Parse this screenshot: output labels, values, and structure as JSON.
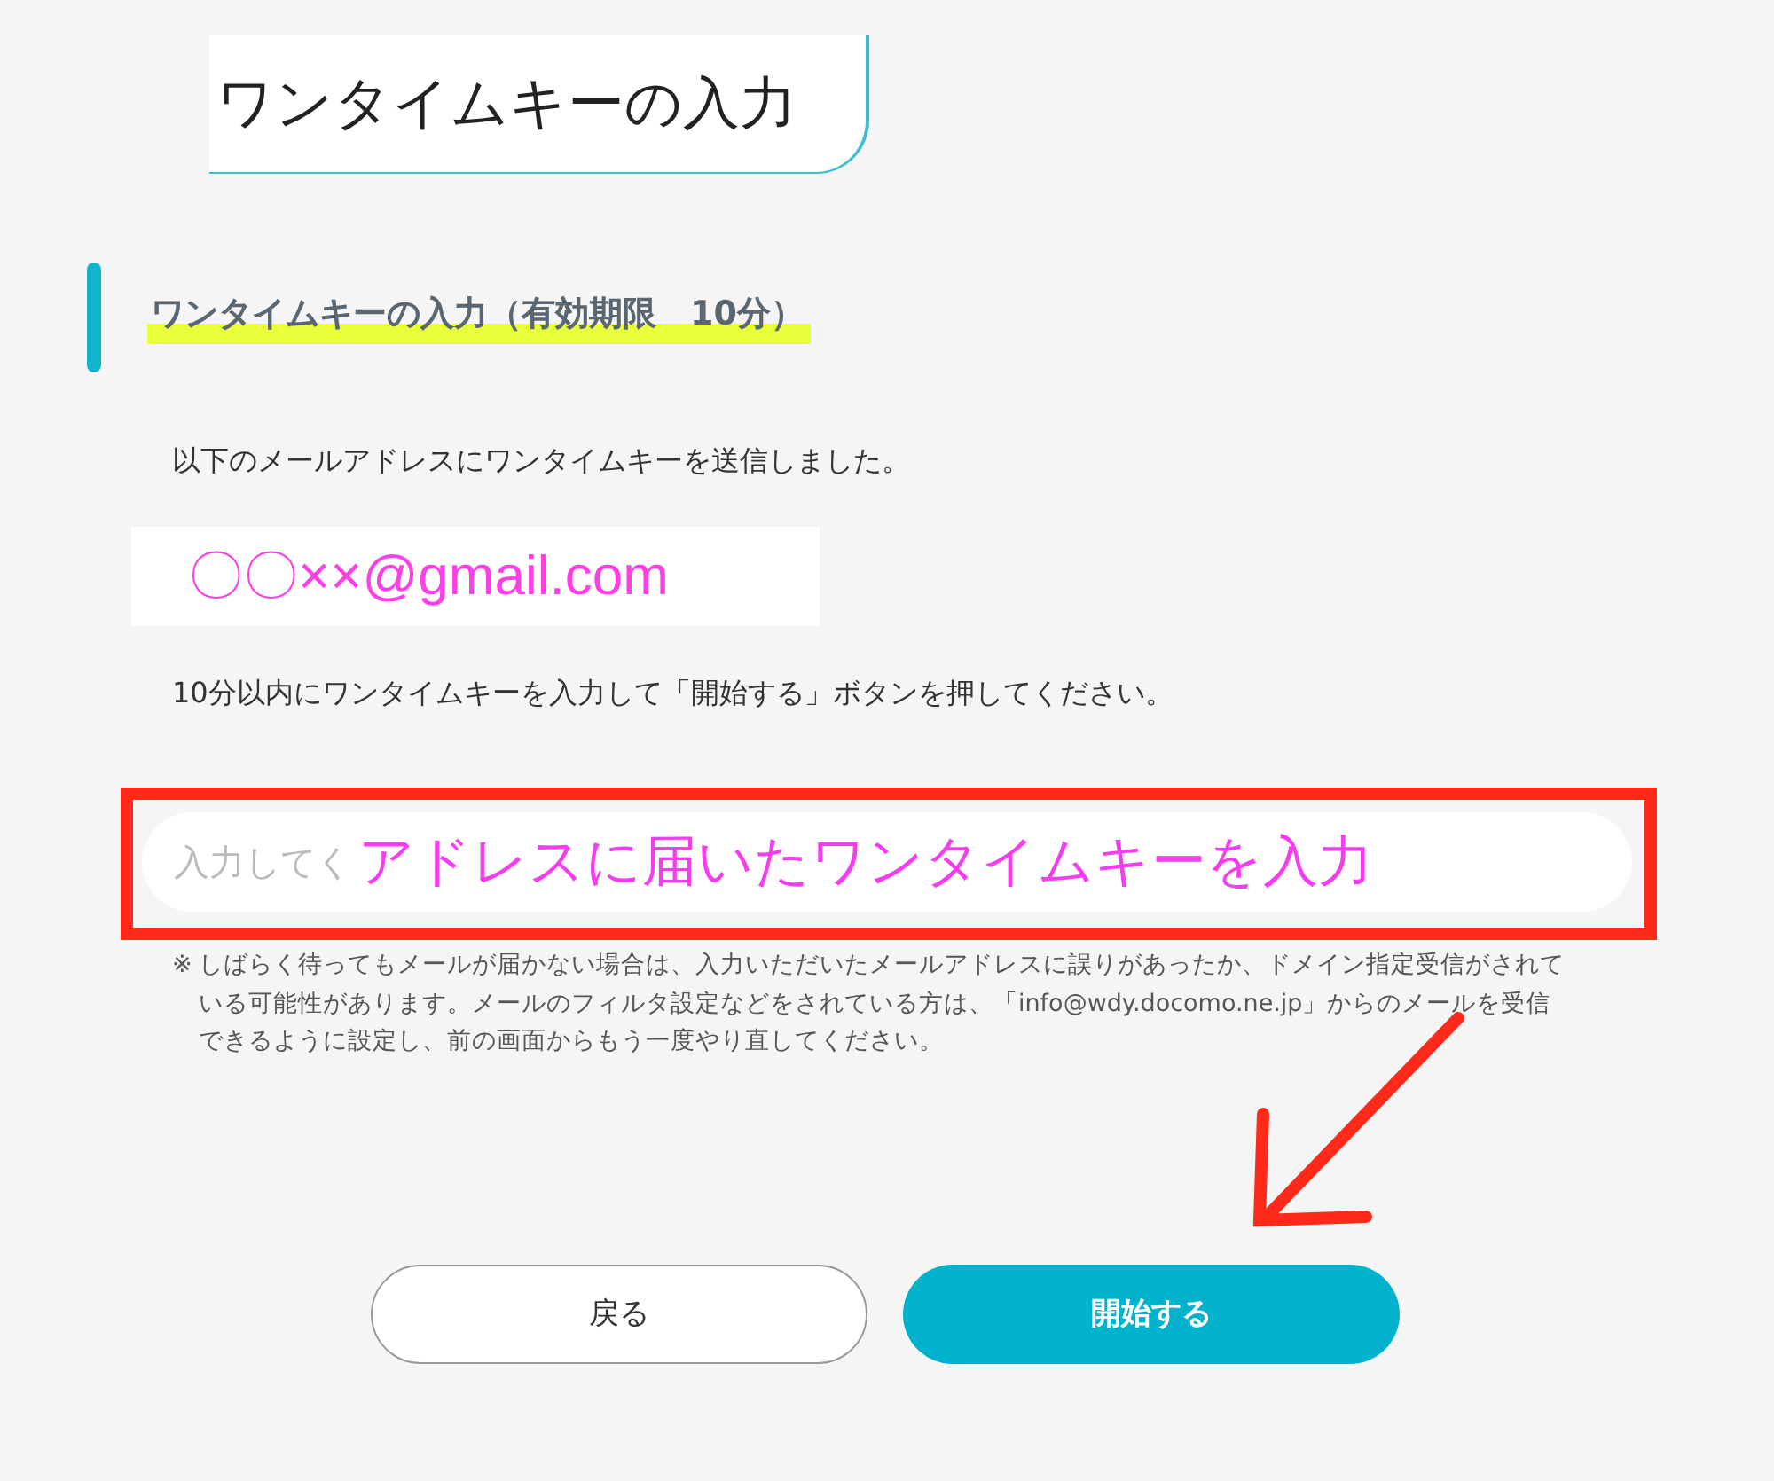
{
  "page_title": "ワンタイムキーの入力",
  "section_heading": "ワンタイムキーの入力（有効期限　10分）",
  "message": "以下のメールアドレスにワンタイムキーを送信しました。",
  "email": "〇〇××@gmail.com",
  "instruction": "10分以内にワンタイムキーを入力して「開始する」ボタンを押してください。",
  "key_field": {
    "placeholder": "入力してく"
  },
  "annotation": "アドレスに届いたワンタイムキーを入力",
  "note": {
    "mark": "※",
    "text": "しばらく待ってもメールが届かない場合は、入力いただいたメールアドレスに誤りがあったか、ドメイン指定受信がされている可能性があります。メールのフィルタ設定などをされている方は、「info@wdy.docomo.ne.jp」からのメールを受信できるように設定し、前の画面からもう一度やり直してください。"
  },
  "buttons": [
    {
      "label": "戻る",
      "kind": "secondary"
    },
    {
      "label": "開始する",
      "kind": "primary"
    }
  ]
}
